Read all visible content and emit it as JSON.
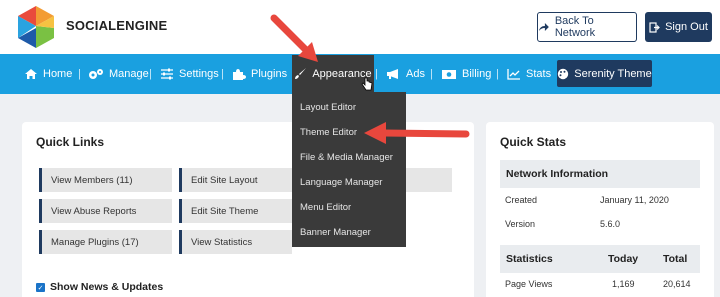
{
  "header": {
    "logo_text": "SOCIALENGINE",
    "back_to_network": "Back To Network",
    "sign_out": "Sign Out"
  },
  "nav": {
    "items": [
      {
        "label": "Home",
        "icon": "home-icon"
      },
      {
        "label": "Manage",
        "icon": "gears-icon"
      },
      {
        "label": "Settings",
        "icon": "sliders-icon"
      },
      {
        "label": "Plugins",
        "icon": "puzzle-icon"
      },
      {
        "label": "Appearance",
        "icon": "brush-icon"
      },
      {
        "label": "Ads",
        "icon": "megaphone-icon"
      },
      {
        "label": "Billing",
        "icon": "money-icon"
      },
      {
        "label": "Stats",
        "icon": "chart-icon"
      },
      {
        "label": "Serenity Theme",
        "icon": "palette-icon"
      }
    ]
  },
  "dropdown": {
    "items": [
      "Layout Editor",
      "Theme Editor",
      "File & Media Manager",
      "Language Manager",
      "Menu Editor",
      "Banner Manager"
    ]
  },
  "quick_links": {
    "title": "Quick Links",
    "col1": [
      "View Members (11)",
      "View Abuse Reports",
      "Manage Plugins (17)"
    ],
    "col2": [
      "Edit Site Layout",
      "Edit Site Theme",
      "View Statistics"
    ],
    "show_news": "Show News & Updates"
  },
  "quick_stats": {
    "title": "Quick Stats",
    "network_info": "Network Information",
    "created_label": "Created",
    "created_value": "January 11, 2020",
    "version_label": "Version",
    "version_value": "5.6.0",
    "statistics": "Statistics",
    "today": "Today",
    "total": "Total",
    "page_views_label": "Page Views",
    "page_views_today": "1,169",
    "page_views_total": "20,614"
  },
  "colors": {
    "nav_blue": "#1aa0e0",
    "dark_navy": "#1f3a5f",
    "dropdown_bg": "#3a3a3a",
    "annotation_red": "#e8473d"
  }
}
